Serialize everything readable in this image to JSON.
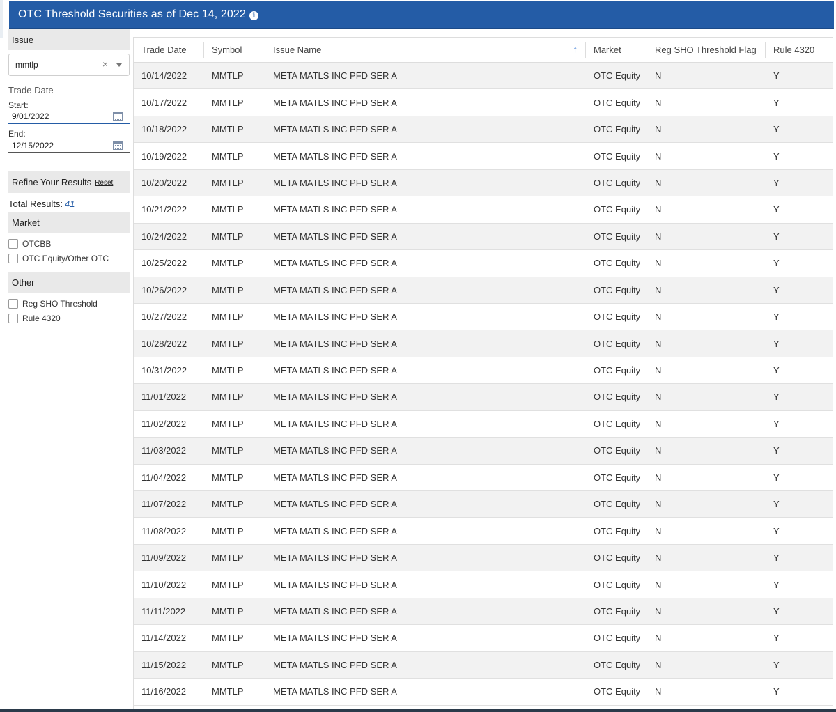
{
  "header": {
    "title": "OTC Threshold Securities as of Dec 14, 2022",
    "info_icon": "info-icon"
  },
  "sidebar": {
    "issue_heading": "Issue",
    "issue_value": "mmtlp",
    "clear_glyph": "×",
    "trade_date_label": "Trade Date",
    "start_label": "Start:",
    "start_value": "9/01/2022",
    "end_label": "End:",
    "end_value": "12/15/2022",
    "refine_label": "Refine Your Results",
    "reset_label": "Reset",
    "total_label": "Total Results:",
    "total_value": "41",
    "market_heading": "Market",
    "market_options": [
      "OTCBB",
      "OTC Equity/Other OTC"
    ],
    "other_heading": "Other",
    "other_options": [
      "Reg SHO Threshold",
      "Rule 4320"
    ]
  },
  "table": {
    "columns": [
      "Trade Date",
      "Symbol",
      "Issue Name",
      "Market",
      "Reg SHO Threshold Flag",
      "Rule 4320"
    ],
    "sort_glyph": "↑",
    "rows": [
      [
        "10/14/2022",
        "MMTLP",
        "META MATLS INC PFD SER A",
        "OTC Equity",
        "N",
        "Y"
      ],
      [
        "10/17/2022",
        "MMTLP",
        "META MATLS INC PFD SER A",
        "OTC Equity",
        "N",
        "Y"
      ],
      [
        "10/18/2022",
        "MMTLP",
        "META MATLS INC PFD SER A",
        "OTC Equity",
        "N",
        "Y"
      ],
      [
        "10/19/2022",
        "MMTLP",
        "META MATLS INC PFD SER A",
        "OTC Equity",
        "N",
        "Y"
      ],
      [
        "10/20/2022",
        "MMTLP",
        "META MATLS INC PFD SER A",
        "OTC Equity",
        "N",
        "Y"
      ],
      [
        "10/21/2022",
        "MMTLP",
        "META MATLS INC PFD SER A",
        "OTC Equity",
        "N",
        "Y"
      ],
      [
        "10/24/2022",
        "MMTLP",
        "META MATLS INC PFD SER A",
        "OTC Equity",
        "N",
        "Y"
      ],
      [
        "10/25/2022",
        "MMTLP",
        "META MATLS INC PFD SER A",
        "OTC Equity",
        "N",
        "Y"
      ],
      [
        "10/26/2022",
        "MMTLP",
        "META MATLS INC PFD SER A",
        "OTC Equity",
        "N",
        "Y"
      ],
      [
        "10/27/2022",
        "MMTLP",
        "META MATLS INC PFD SER A",
        "OTC Equity",
        "N",
        "Y"
      ],
      [
        "10/28/2022",
        "MMTLP",
        "META MATLS INC PFD SER A",
        "OTC Equity",
        "N",
        "Y"
      ],
      [
        "10/31/2022",
        "MMTLP",
        "META MATLS INC PFD SER A",
        "OTC Equity",
        "N",
        "Y"
      ],
      [
        "11/01/2022",
        "MMTLP",
        "META MATLS INC PFD SER A",
        "OTC Equity",
        "N",
        "Y"
      ],
      [
        "11/02/2022",
        "MMTLP",
        "META MATLS INC PFD SER A",
        "OTC Equity",
        "N",
        "Y"
      ],
      [
        "11/03/2022",
        "MMTLP",
        "META MATLS INC PFD SER A",
        "OTC Equity",
        "N",
        "Y"
      ],
      [
        "11/04/2022",
        "MMTLP",
        "META MATLS INC PFD SER A",
        "OTC Equity",
        "N",
        "Y"
      ],
      [
        "11/07/2022",
        "MMTLP",
        "META MATLS INC PFD SER A",
        "OTC Equity",
        "N",
        "Y"
      ],
      [
        "11/08/2022",
        "MMTLP",
        "META MATLS INC PFD SER A",
        "OTC Equity",
        "N",
        "Y"
      ],
      [
        "11/09/2022",
        "MMTLP",
        "META MATLS INC PFD SER A",
        "OTC Equity",
        "N",
        "Y"
      ],
      [
        "11/10/2022",
        "MMTLP",
        "META MATLS INC PFD SER A",
        "OTC Equity",
        "N",
        "Y"
      ],
      [
        "11/11/2022",
        "MMTLP",
        "META MATLS INC PFD SER A",
        "OTC Equity",
        "N",
        "Y"
      ],
      [
        "11/14/2022",
        "MMTLP",
        "META MATLS INC PFD SER A",
        "OTC Equity",
        "N",
        "Y"
      ],
      [
        "11/15/2022",
        "MMTLP",
        "META MATLS INC PFD SER A",
        "OTC Equity",
        "N",
        "Y"
      ],
      [
        "11/16/2022",
        "MMTLP",
        "META MATLS INC PFD SER A",
        "OTC Equity",
        "N",
        "Y"
      ]
    ]
  }
}
